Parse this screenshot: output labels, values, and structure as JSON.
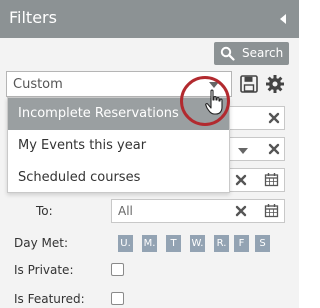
{
  "header": {
    "title": "Filters",
    "collapse_icon": "chevron-left-icon"
  },
  "toolbar": {
    "search_label": "Search",
    "search_icon": "magnifier-icon"
  },
  "preset": {
    "selected": "Custom",
    "save_icon": "floppy-disk-icon",
    "settings_icon": "gear-icon"
  },
  "preset_menu": {
    "items": [
      {
        "label": "Incomplete Reservations",
        "highlighted": true
      },
      {
        "label": "My Events this year",
        "highlighted": false
      },
      {
        "label": "Scheduled courses",
        "highlighted": false
      }
    ]
  },
  "date_filter": {
    "to_label": "To:",
    "to_value": "All"
  },
  "day_met": {
    "label": "Day Met:",
    "days": [
      "U.",
      "M.",
      "T",
      "W.",
      "R.",
      "F",
      "S"
    ]
  },
  "is_private": {
    "label": "Is Private:",
    "checked": false
  },
  "is_featured": {
    "label": "Is Featured:",
    "checked": false
  },
  "colors": {
    "header_bg": "#8c9294",
    "menu_highlight": "#9a9fa1",
    "day_button": "#93a3b3",
    "highlight_ring": "#b22a2f"
  }
}
